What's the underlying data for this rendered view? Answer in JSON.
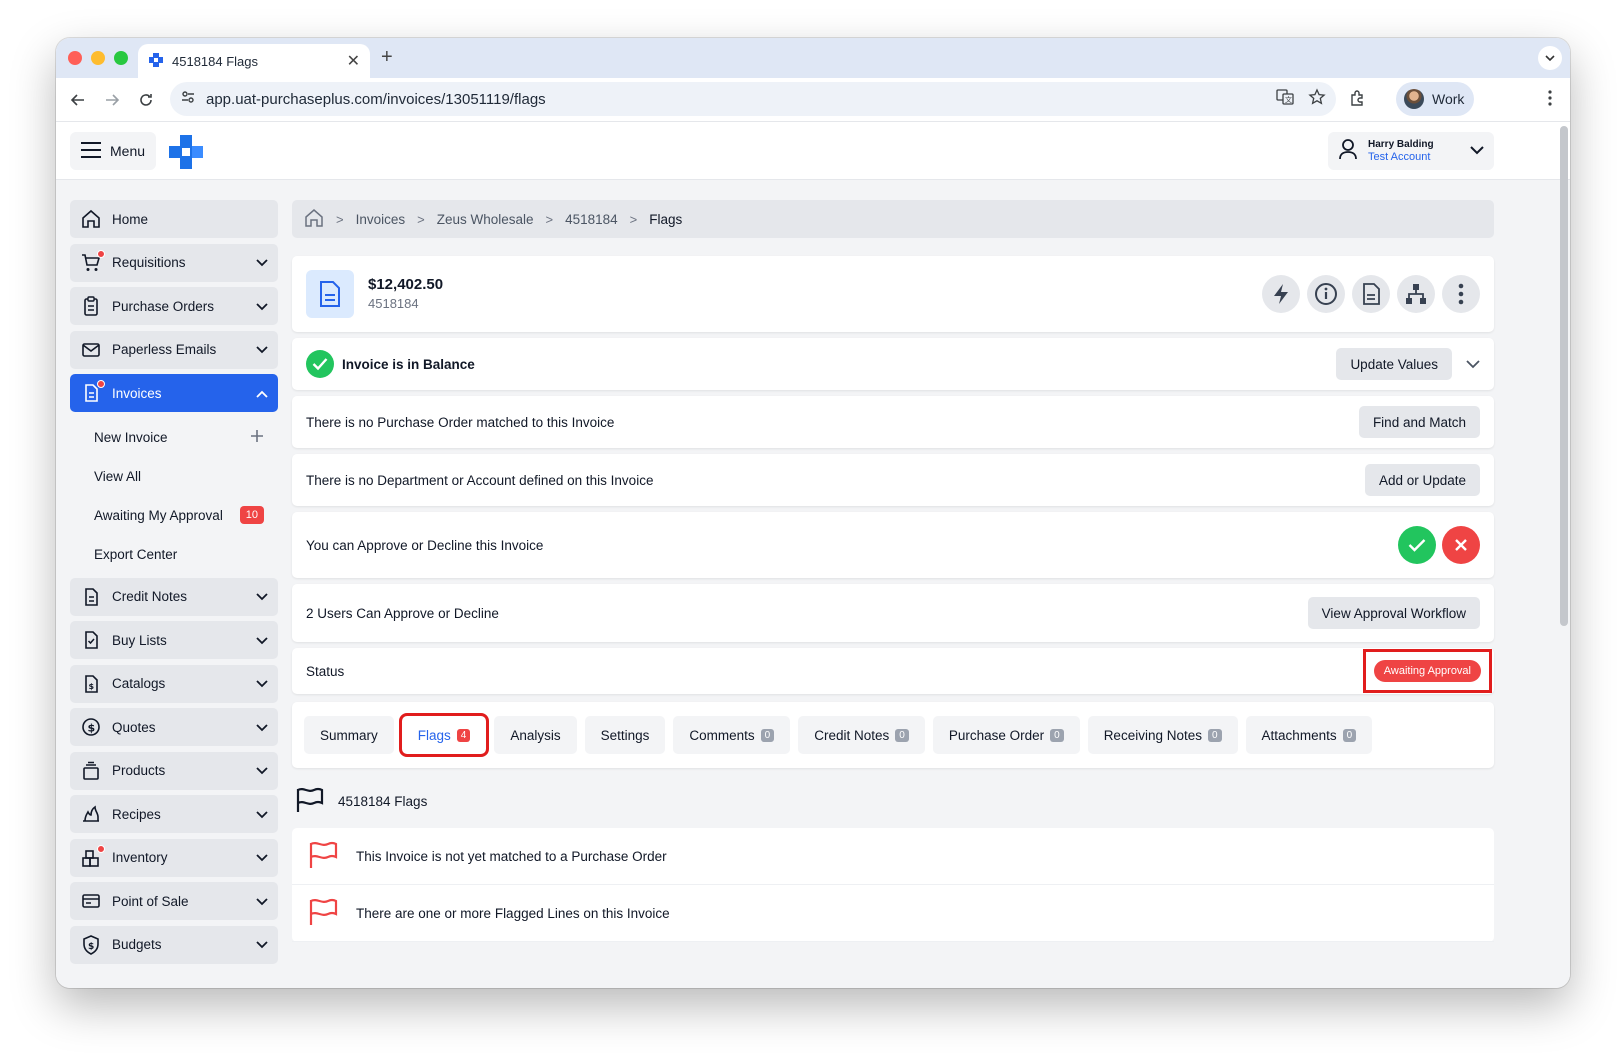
{
  "browser": {
    "tab_title": "4518184 Flags",
    "url": "app.uat-purchaseplus.com/invoices/13051119/flags",
    "profile_label": "Work"
  },
  "header": {
    "menu_label": "Menu",
    "user_name": "Harry Balding",
    "user_account": "Test Account"
  },
  "sidebar": {
    "items": [
      {
        "label": "Home",
        "icon": "home-icon"
      },
      {
        "label": "Requisitions",
        "icon": "cart-icon"
      },
      {
        "label": "Purchase Orders",
        "icon": "clipboard-icon"
      },
      {
        "label": "Paperless Emails",
        "icon": "envelope-icon"
      },
      {
        "label": "Invoices",
        "icon": "invoice-icon"
      },
      {
        "label": "Credit Notes",
        "icon": "document-icon"
      },
      {
        "label": "Buy Lists",
        "icon": "checklist-icon"
      },
      {
        "label": "Catalogs",
        "icon": "catalog-icon"
      },
      {
        "label": "Quotes",
        "icon": "dollar-circle-icon"
      },
      {
        "label": "Products",
        "icon": "products-icon"
      },
      {
        "label": "Recipes",
        "icon": "flame-icon"
      },
      {
        "label": "Inventory",
        "icon": "inventory-icon"
      },
      {
        "label": "Point of Sale",
        "icon": "pos-icon"
      },
      {
        "label": "Budgets",
        "icon": "shield-dollar-icon"
      }
    ],
    "invoices_sub": {
      "new_invoice": "New Invoice",
      "view_all": "View All",
      "awaiting": "Awaiting My Approval",
      "awaiting_count": "10",
      "export_center": "Export Center"
    }
  },
  "breadcrumb": [
    "Invoices",
    "Zeus Wholesale",
    "4518184",
    "Flags"
  ],
  "invoice": {
    "amount": "$12,402.50",
    "number": "4518184"
  },
  "rows": {
    "balance_text": "Invoice is in Balance",
    "update_values": "Update Values",
    "no_po_text": "There is no Purchase Order matched to this Invoice",
    "find_match": "Find and Match",
    "no_dept_text": "There is no Department or Account defined on this Invoice",
    "add_update": "Add or Update",
    "approve_text": "You can Approve or Decline this Invoice",
    "users_text": "2 Users Can Approve or Decline",
    "view_workflow": "View Approval Workflow",
    "status_label": "Status",
    "status_value": "Awaiting Approval"
  },
  "tabs": [
    {
      "label": "Summary",
      "count": null
    },
    {
      "label": "Flags",
      "count": "4"
    },
    {
      "label": "Analysis",
      "count": null
    },
    {
      "label": "Settings",
      "count": null
    },
    {
      "label": "Comments",
      "count": "0"
    },
    {
      "label": "Credit Notes",
      "count": "0"
    },
    {
      "label": "Purchase Order",
      "count": "0"
    },
    {
      "label": "Receiving Notes",
      "count": "0"
    },
    {
      "label": "Attachments",
      "count": "0"
    }
  ],
  "flags": {
    "heading": "4518184 Flags",
    "items": [
      "This Invoice is not yet matched to a Purchase Order",
      "There are one or more Flagged Lines on this Invoice"
    ]
  },
  "colors": {
    "accent": "#2563eb",
    "success": "#22c55e",
    "danger": "#ef4444",
    "highlight": "#e11d1d"
  }
}
